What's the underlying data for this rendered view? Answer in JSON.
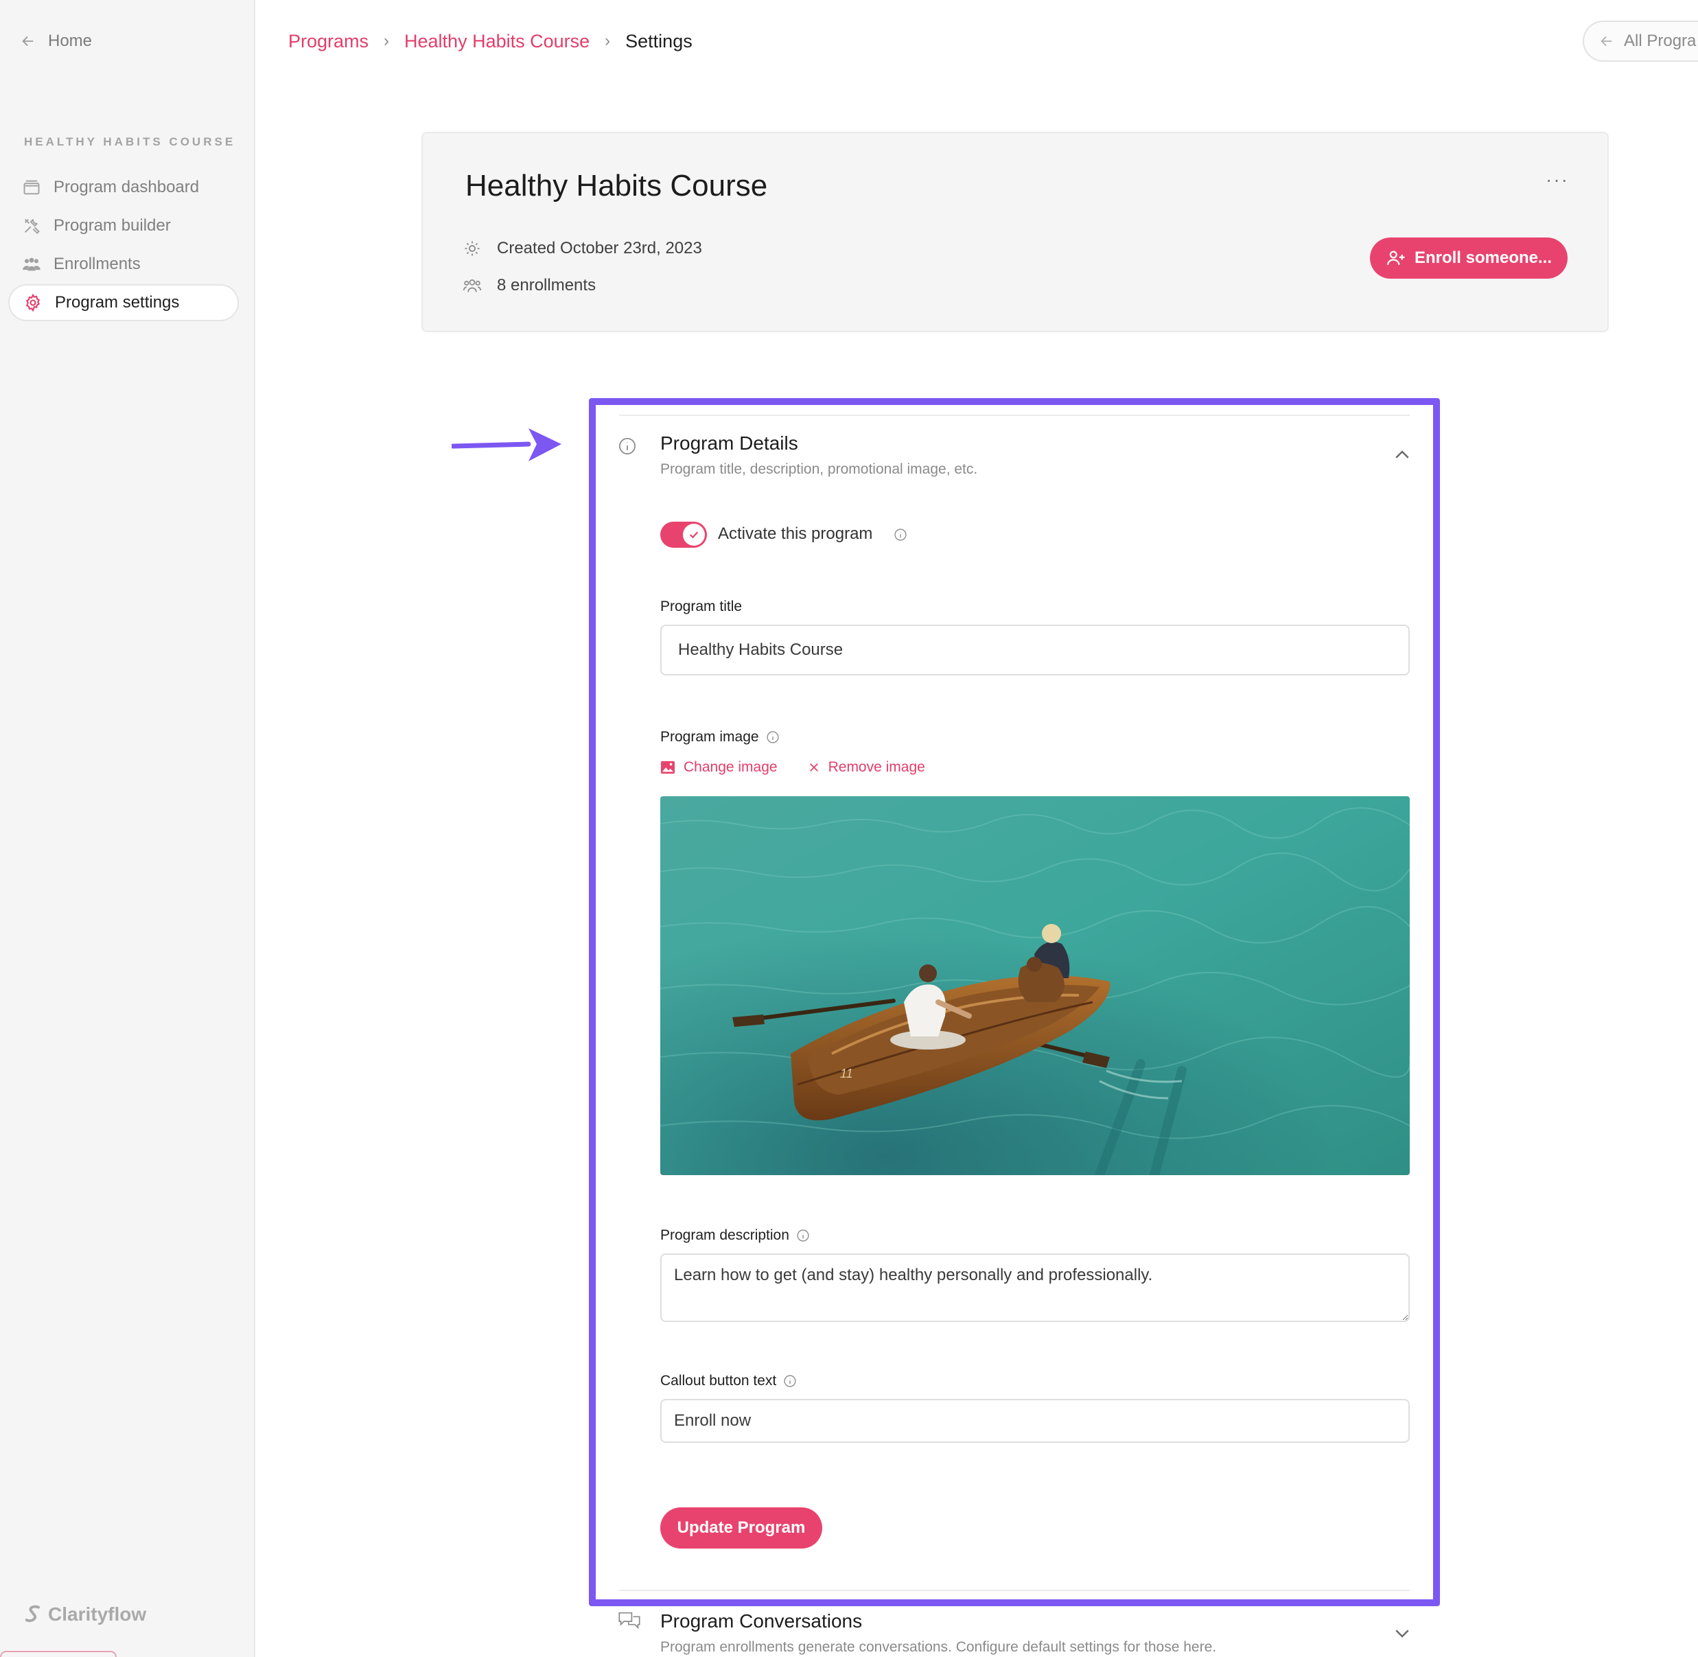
{
  "sidebar": {
    "home_label": "Home",
    "section_label": "HEALTHY HABITS COURSE",
    "items": [
      {
        "label": "Program dashboard"
      },
      {
        "label": "Program builder"
      },
      {
        "label": "Enrollments"
      },
      {
        "label": "Program settings"
      }
    ],
    "brand": "Clarityflow"
  },
  "breadcrumb": {
    "programs": "Programs",
    "course": "Healthy Habits Course",
    "current": "Settings",
    "sep": "›"
  },
  "header": {
    "all_programs": "All Progra"
  },
  "card": {
    "title": "Healthy Habits Course",
    "more": "···",
    "created": "Created October 23rd, 2023",
    "enrollments": "8 enrollments",
    "enroll_button": "Enroll someone..."
  },
  "details": {
    "title": "Program Details",
    "subtitle": "Program title, description, promotional image, etc.",
    "activate_label": "Activate this program",
    "title_label": "Program title",
    "title_value": "Healthy Habits Course",
    "image_label": "Program image",
    "change_image": "Change image",
    "remove_image": "Remove image",
    "boat_number": "11",
    "description_label": "Program description",
    "description_value": "Learn how to get (and stay) healthy personally and professionally.",
    "callout_label": "Callout button text",
    "callout_value": "Enroll now",
    "update_button": "Update Program"
  },
  "conversations": {
    "title": "Program Conversations",
    "subtitle": "Program enrollments generate conversations. Configure default settings for those here."
  },
  "colors": {
    "accent": "#e8436e",
    "highlight": "#7c57f2",
    "sidebar_bg": "#f6f5f6"
  }
}
